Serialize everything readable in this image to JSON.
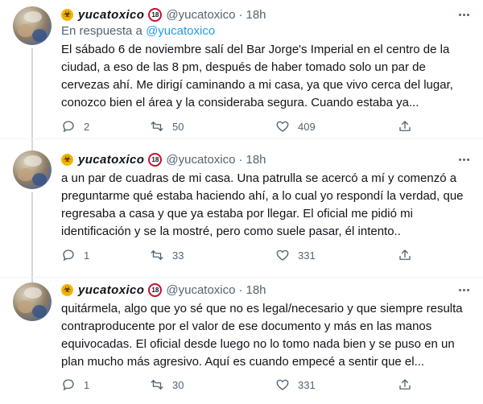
{
  "tweets": [
    {
      "display_name": "yucatoxico",
      "age_badge": "18",
      "handle": "@yucatoxico",
      "separator": "·",
      "time": "18h",
      "reply_prefix": "En respuesta a ",
      "reply_mention": "@yucatoxico",
      "lines": [
        "El sábado 6 de noviembre salí del Bar Jorge's Imperial en el centro de la",
        "ciudad, a eso de las 8 pm, después de haber tomado solo un par de",
        "cervezas ahí. Me dirigí caminando a mi casa, ya que vivo cerca del lugar,",
        "conozco bien el área y la consideraba segura. Cuando estaba ya..."
      ],
      "replies": "2",
      "retweets": "50",
      "likes": "409"
    },
    {
      "display_name": "yucatoxico",
      "age_badge": "18",
      "handle": "@yucatoxico",
      "separator": "·",
      "time": "18h",
      "lines": [
        "a un par de cuadras de mi casa. Una patrulla se acercó a mí y comenzó a",
        "preguntarme qué estaba haciendo ahí, a lo cual yo respondí la verdad, que",
        "regresaba a casa y que ya estaba por llegar. El oficial me pidió mi",
        "identificación y se la mostré, pero como suele pasar, él intento.."
      ],
      "replies": "1",
      "retweets": "33",
      "likes": "331"
    },
    {
      "display_name": "yucatoxico",
      "age_badge": "18",
      "handle": "@yucatoxico",
      "separator": "·",
      "time": "18h",
      "lines": [
        "quitármela, algo que yo sé que no es legal/necesario y que siempre resulta",
        "contraproducente por el valor de ese documento y más en las manos",
        "equivocadas. El oficial desde luego no lo tomo nada bien y se puso en un",
        "plan mucho más agresivo. Aquí es cuando empecé a sentir que el..."
      ],
      "replies": "1",
      "retweets": "30",
      "likes": "331"
    }
  ],
  "icons": {
    "reply": "reply-icon",
    "retweet": "retweet-icon",
    "like": "heart-icon",
    "share": "share-icon",
    "more": "more-icon",
    "badge": "biohazard-badge-icon"
  },
  "colors": {
    "text": "#0f1419",
    "secondary": "#536471",
    "link": "#1d9bf0",
    "divider": "#eff3f4",
    "age_ring": "#c8102e",
    "badge": "#f4b400"
  }
}
